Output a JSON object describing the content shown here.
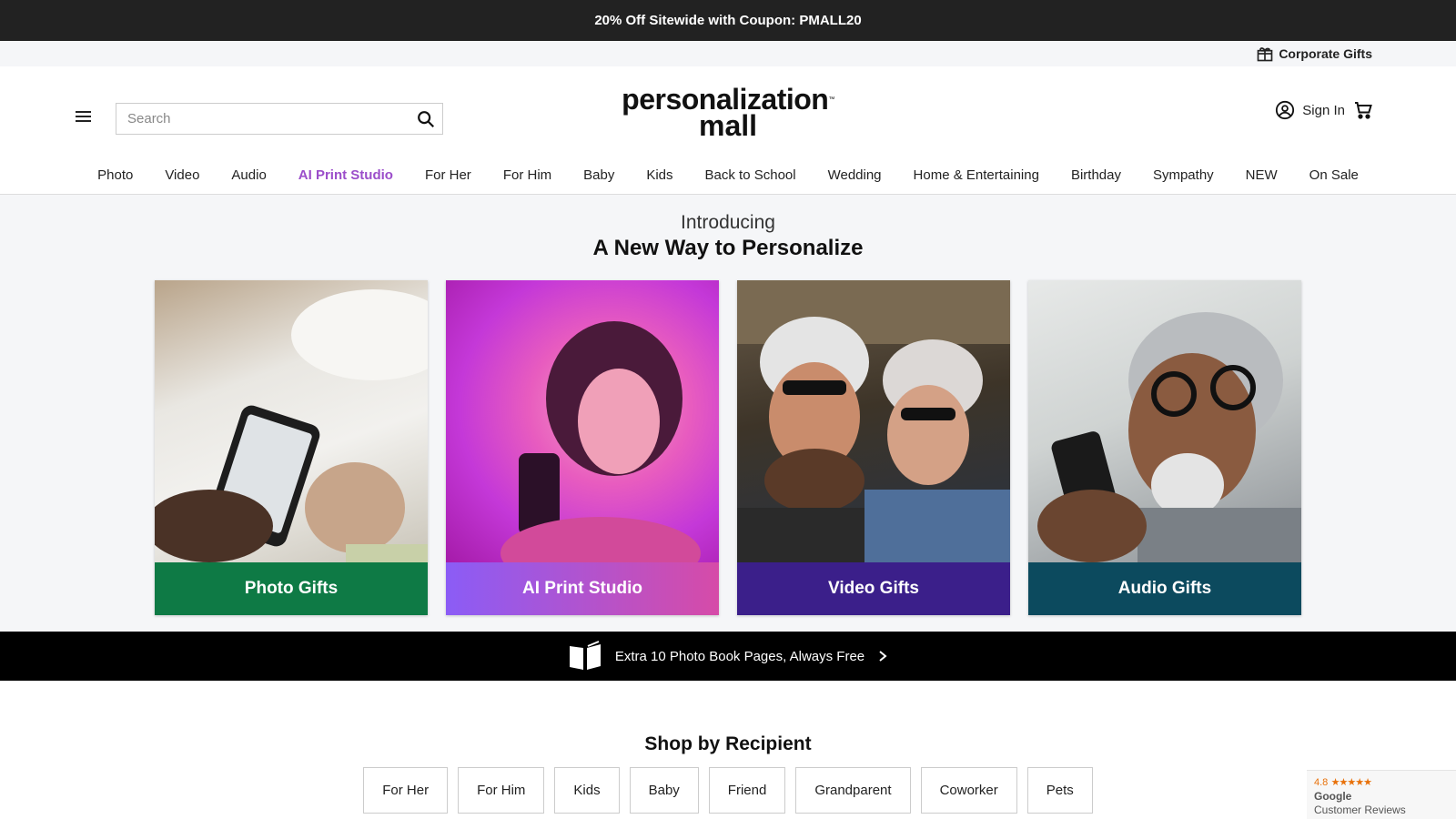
{
  "promo": {
    "text": "20% Off Sitewide with Coupon: PMALL20"
  },
  "corporate": {
    "label": "Corporate Gifts",
    "icon": "gift-icon"
  },
  "header": {
    "search_placeholder": "Search",
    "logo_line1": "personalization",
    "logo_tm": "™",
    "logo_line2": "mall",
    "sign_in": "Sign In"
  },
  "nav": {
    "items": [
      "Photo",
      "Video",
      "Audio",
      "AI Print Studio",
      "For Her",
      "For Him",
      "Baby",
      "Kids",
      "Back to School",
      "Wedding",
      "Home & Entertaining",
      "Birthday",
      "Sympathy",
      "NEW",
      "On Sale"
    ],
    "accent_color": "#9b4dca"
  },
  "hero": {
    "intro": "Introducing",
    "headline": "A New Way to Personalize",
    "cards": [
      {
        "label": "Photo Gifts",
        "color": "#0e7a45"
      },
      {
        "label": "AI Print Studio",
        "color": "#b052d0"
      },
      {
        "label": "Video Gifts",
        "color": "#3b1f8a"
      },
      {
        "label": "Audio Gifts",
        "color": "#0c4a5e"
      }
    ]
  },
  "photo_banner": {
    "text": "Extra 10 Photo Book Pages, Always Free",
    "icon": "open-book-icon"
  },
  "recipient": {
    "title": "Shop by Recipient",
    "chips": [
      "For Her",
      "For Him",
      "Kids",
      "Baby",
      "Friend",
      "Grandparent",
      "Coworker",
      "Pets"
    ]
  },
  "reviews": {
    "rating": "4.8",
    "stars": "★★★★★",
    "source": "Google",
    "label": "Customer Reviews"
  }
}
